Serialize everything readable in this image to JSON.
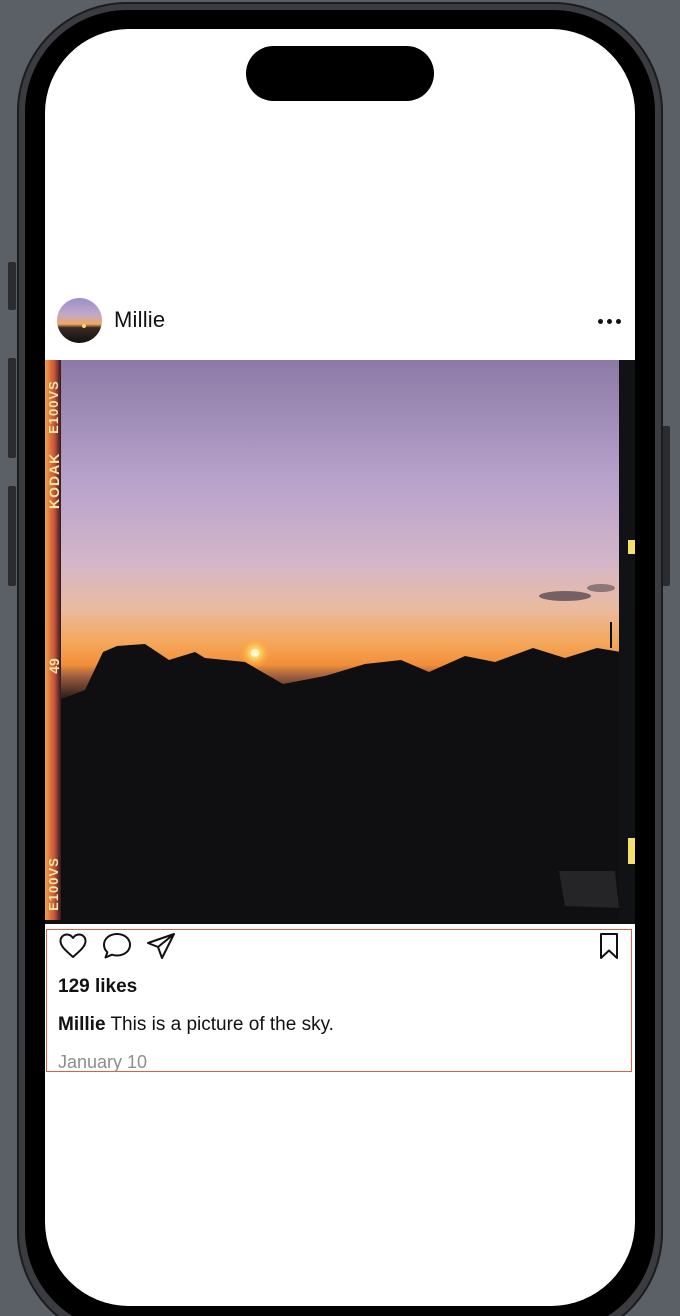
{
  "post": {
    "username": "Millie",
    "image": {
      "film_text": [
        "KODAK",
        "E100VS",
        "49",
        "E100VS"
      ]
    },
    "likes": "129 likes",
    "caption_user": "Millie",
    "caption_text": "This is a picture of the sky.",
    "date": "January 10"
  },
  "icons": {
    "more": "ellipsis-icon",
    "like": "heart-icon",
    "comment": "comment-bubble-icon",
    "share": "paper-plane-icon",
    "bookmark": "bookmark-icon"
  },
  "colors": {
    "outline": "#d9604a",
    "date_text": "#8e8e8e",
    "text": "#111111"
  }
}
